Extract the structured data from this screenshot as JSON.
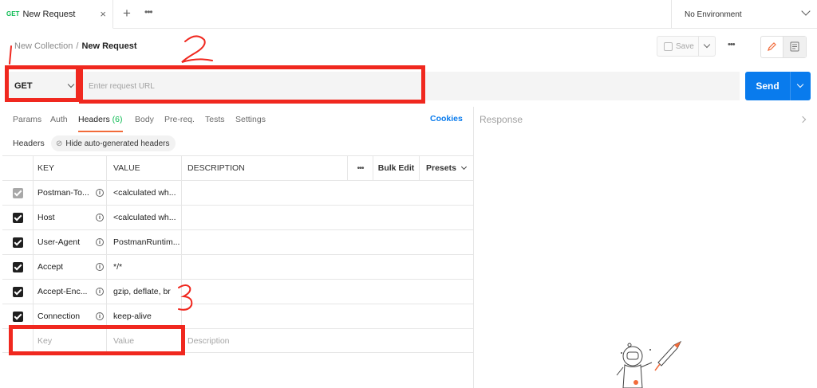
{
  "tabs": [
    {
      "method": "GET",
      "title": "New Request",
      "close": "×"
    }
  ],
  "tabbar": {
    "add": "+",
    "more": "•••"
  },
  "environment": {
    "label": "No Environment"
  },
  "breadcrumb": {
    "collection": "New Collection",
    "separator": "/",
    "request": "New Request"
  },
  "toolbar": {
    "save_label": "Save",
    "more": "•••"
  },
  "request": {
    "method": "GET",
    "url_placeholder": "Enter request URL",
    "url_value": "",
    "send_label": "Send"
  },
  "request_tabs": [
    {
      "label": "Params"
    },
    {
      "label": "Auth"
    },
    {
      "label": "Headers",
      "count": "(6)"
    },
    {
      "label": "Body"
    },
    {
      "label": "Pre-req."
    },
    {
      "label": "Tests"
    },
    {
      "label": "Settings"
    }
  ],
  "cookies_label": "Cookies",
  "headers_section": {
    "label": "Headers",
    "hide_auto_label": "Hide auto-generated headers"
  },
  "table": {
    "columns": {
      "key": "KEY",
      "value": "VALUE",
      "description": "DESCRIPTION",
      "more": "•••",
      "bulk_edit": "Bulk Edit",
      "presets": "Presets"
    },
    "rows": [
      {
        "key": "Postman-To...",
        "value": "<calculated wh...",
        "checked": true,
        "disabled": true
      },
      {
        "key": "Host",
        "value": "<calculated wh...",
        "checked": true,
        "disabled": false
      },
      {
        "key": "User-Agent",
        "value": "PostmanRuntim...",
        "checked": true,
        "disabled": false
      },
      {
        "key": "Accept",
        "value": "*/*",
        "checked": true,
        "disabled": false
      },
      {
        "key": "Accept-Enc...",
        "value": "gzip, deflate, br",
        "checked": true,
        "disabled": false
      },
      {
        "key": "Connection",
        "value": "keep-alive",
        "checked": true,
        "disabled": false
      }
    ],
    "new_row": {
      "key_placeholder": "Key",
      "value_placeholder": "Value",
      "description_placeholder": "Description"
    }
  },
  "response": {
    "label": "Response"
  },
  "annotations": {
    "label_1": "1",
    "label_2": "2",
    "label_3": "3",
    "color": "#f0281f"
  },
  "colors": {
    "accent": "#097bed",
    "method_get": "#0cbb52",
    "tab_underline": "#f26b3a"
  }
}
